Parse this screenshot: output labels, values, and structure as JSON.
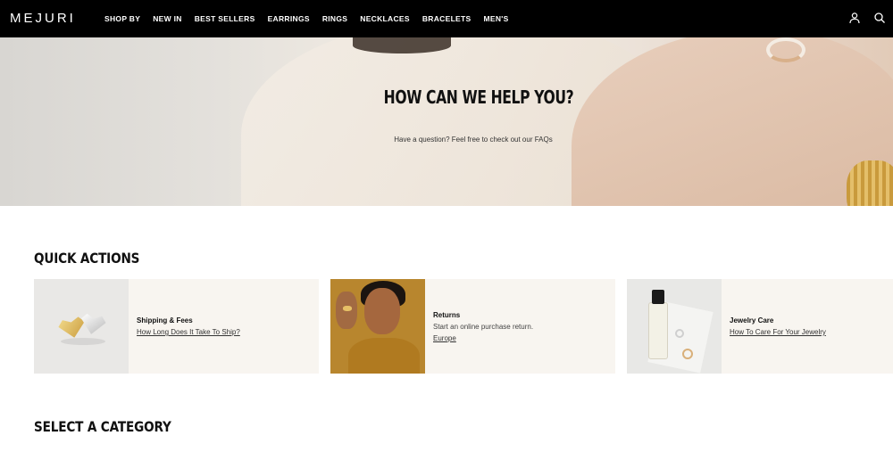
{
  "brand": {
    "logo": "MEJURI"
  },
  "nav": {
    "items": [
      "SHOP BY",
      "NEW IN",
      "BEST SELLERS",
      "EARRINGS",
      "RINGS",
      "NECKLACES",
      "BRACELETS",
      "MEN'S"
    ],
    "icons": [
      "account-icon",
      "search-icon"
    ]
  },
  "hero": {
    "title": "HOW CAN WE HELP YOU?",
    "subtitle": "Have a question? Feel free to check out our FAQs"
  },
  "quick_actions": {
    "title": "QUICK ACTIONS",
    "cards": [
      {
        "title": "Shipping & Fees",
        "desc": "",
        "link": "How Long Does It Take To Ship?"
      },
      {
        "title": "Returns",
        "desc": "Start an online purchase return.",
        "link": "Europe"
      },
      {
        "title": "Jewelry Care",
        "desc": "",
        "link": "How To Care For Your Jewelry"
      }
    ]
  },
  "category": {
    "title": "SELECT A CATEGORY"
  }
}
